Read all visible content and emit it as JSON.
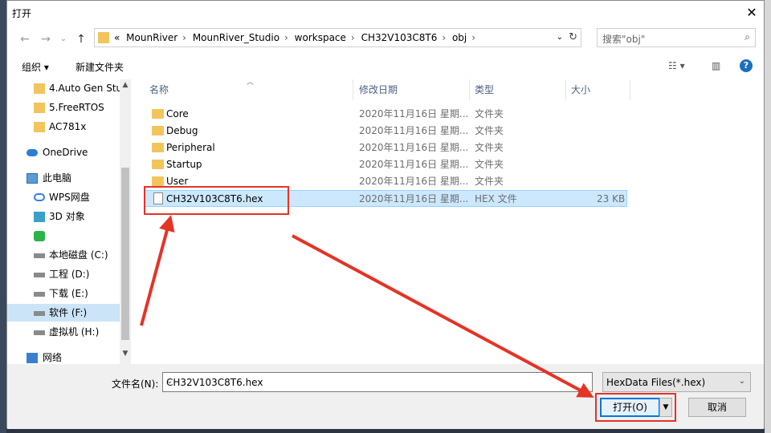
{
  "dialog": {
    "title": "打开",
    "close": "✕"
  },
  "nav": {
    "back": "←",
    "forward": "→",
    "recent": "⌄",
    "up": "↑"
  },
  "address": {
    "overflow": "«",
    "crumbs": [
      "MounRiver",
      "MounRiver_Studio",
      "workspace",
      "CH32V103C8T6",
      "obj"
    ]
  },
  "search": {
    "placeholder": "搜索\"obj\""
  },
  "toolbar": {
    "organize": "组织 ▾",
    "new_folder": "新建文件夹"
  },
  "sidebar": {
    "items": [
      {
        "label": "4.Auto Gen Stu",
        "icon": "folder-icon"
      },
      {
        "label": "5.FreeRTOS",
        "icon": "folder-icon"
      },
      {
        "label": "AC781x",
        "icon": "folder-icon"
      },
      {
        "label": "OneDrive",
        "icon": "cloud-icon"
      },
      {
        "label": "此电脑",
        "icon": "computer-icon"
      },
      {
        "label": "WPS网盘",
        "icon": "cloud-drive-icon"
      },
      {
        "label": "3D 对象",
        "icon": "cube-icon"
      },
      {
        "label": "",
        "icon": "app-icon"
      },
      {
        "label": "本地磁盘 (C:)",
        "icon": "drive-icon"
      },
      {
        "label": "工程 (D:)",
        "icon": "drive-icon"
      },
      {
        "label": "下载 (E:)",
        "icon": "drive-icon"
      },
      {
        "label": "软件 (F:)",
        "icon": "drive-icon"
      },
      {
        "label": "虚拟机 (H:)",
        "icon": "drive-icon"
      },
      {
        "label": "网络",
        "icon": "network-icon"
      }
    ]
  },
  "columns": {
    "name": "名称",
    "date": "修改日期",
    "type": "类型",
    "size": "大小"
  },
  "files": [
    {
      "name": "Core",
      "date": "2020年11月16日 星期...",
      "type": "文件夹",
      "size": ""
    },
    {
      "name": "Debug",
      "date": "2020年11月16日 星期...",
      "type": "文件夹",
      "size": ""
    },
    {
      "name": "Peripheral",
      "date": "2020年11月16日 星期...",
      "type": "文件夹",
      "size": ""
    },
    {
      "name": "Startup",
      "date": "2020年11月16日 星期...",
      "type": "文件夹",
      "size": ""
    },
    {
      "name": "User",
      "date": "2020年11月16日 星期...",
      "type": "文件夹",
      "size": ""
    },
    {
      "name": "CH32V103C8T6.hex",
      "date": "2020年11月16日 星期...",
      "type": "HEX 文件",
      "size": "23 KB"
    }
  ],
  "footer": {
    "filename_label": "文件名(N):",
    "filename_value": "CH32V103C8T6.hex",
    "filetype_value": "HexData Files(*.hex)",
    "open_label": "打开(O)",
    "cancel_label": "取消"
  },
  "colors": {
    "highlight": "#e53326",
    "selection": "#cce8ff",
    "accent": "#0078d7"
  }
}
